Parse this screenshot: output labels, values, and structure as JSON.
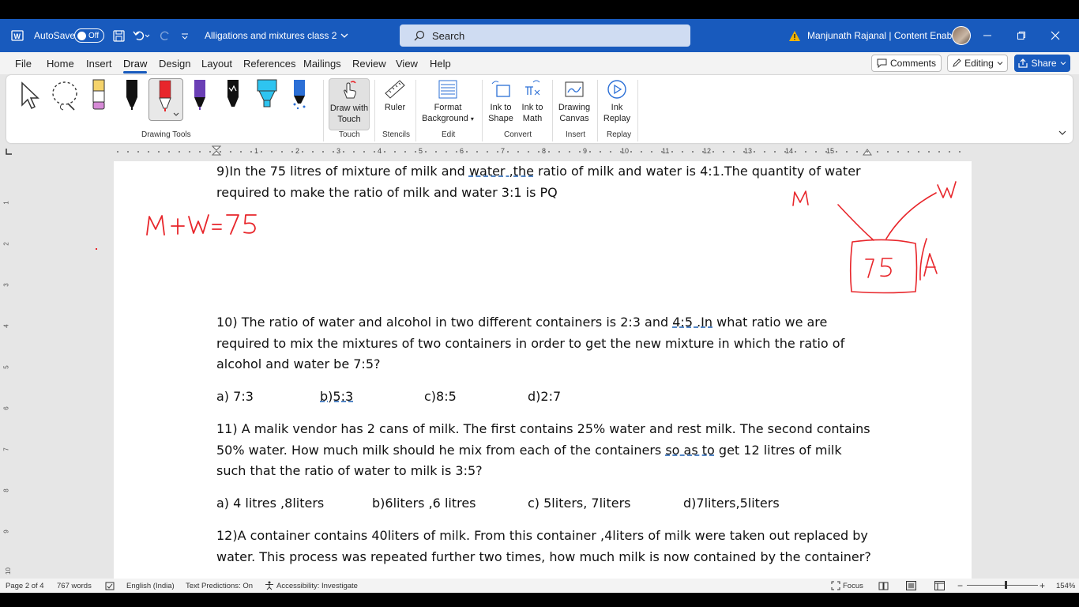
{
  "titlebar": {
    "autosave_label": "AutoSave",
    "autosave_state": "Off",
    "doc_title": "Alligations and mixtures class 2",
    "search_placeholder": "Search",
    "user_name": "Manjunath Rajanal | Content Enablers"
  },
  "menu": {
    "tabs": [
      "File",
      "Home",
      "Insert",
      "Draw",
      "Design",
      "Layout",
      "References",
      "Mailings",
      "Review",
      "View",
      "Help"
    ],
    "active": "Draw",
    "comments_label": "Comments",
    "editing_label": "Editing",
    "share_label": "Share"
  },
  "ribbon": {
    "draw_with_touch": [
      "Draw with",
      "Touch"
    ],
    "ruler": "Ruler",
    "format_background": [
      "Format",
      "Background"
    ],
    "ink_to_shape": [
      "Ink to",
      "Shape"
    ],
    "ink_to_math": [
      "Ink to",
      "Math"
    ],
    "drawing_canvas": [
      "Drawing",
      "Canvas"
    ],
    "ink_replay": [
      "Ink",
      "Replay"
    ],
    "groups": {
      "drawing_tools": "Drawing Tools",
      "touch": "Touch",
      "stencils": "Stencils",
      "edit": "Edit",
      "convert": "Convert",
      "insert": "Insert",
      "replay": "Replay"
    }
  },
  "ruler": {
    "numbers": [
      "1",
      "2",
      "3",
      "4",
      "5",
      "6",
      "7",
      "8",
      "9",
      "10",
      "11",
      "12",
      "13",
      "14",
      "15"
    ],
    "vnumbers": [
      "1",
      "2",
      "3",
      "4",
      "5",
      "6",
      "7",
      "8",
      "9",
      "10"
    ]
  },
  "document": {
    "q9": {
      "part1": "9)In the 75 litres of mixture of milk and ",
      "link": "water ,the",
      "part2": " ratio of milk and water is 4:1.The quantity of water required to make the ratio of milk and water 3:1 is PQ"
    },
    "q10": {
      "part1": "10) The ratio of water and alcohol in two different containers is 2:3 and ",
      "link": "4:5 .In",
      "part2": " what ratio we are required to mix the mixtures of two containers in order to get the new mixture in which the ratio of alcohol and water be 7:5?",
      "options": [
        "a) 7:3",
        "b)5:3",
        "c)8:5",
        "d)2:7"
      ]
    },
    "q11": {
      "part1": "11) A malik vendor has 2 cans of milk. The first contains 25% water and rest milk. The second contains 50% water. How much milk should he mix from each of the containers ",
      "link": "so as to",
      "part2": " get 12 litres of milk such that the ratio of water to milk is 3:5?",
      "options": [
        "a) 4 litres ,8liters",
        "b)6liters ,6 litres",
        "c) 5liters, 7liters",
        "d)7liters,5liters"
      ]
    },
    "q12": {
      "text": "12)A container contains 40liters of milk. From this container ,4liters of milk were taken out replaced by water. This process was repeated further two times, how much milk is now contained by the container?"
    }
  },
  "ink": {
    "color": "#e8262b",
    "equation": "M+W=75",
    "label_m": "M",
    "label_w": "W",
    "box_value": "75",
    "label_a": "A"
  },
  "status": {
    "page": "Page 2 of 4",
    "words": "767 words",
    "language": "English (India)",
    "predictions": "Text Predictions: On",
    "accessibility": "Accessibility: Investigate",
    "focus": "Focus",
    "zoom": "154%"
  }
}
